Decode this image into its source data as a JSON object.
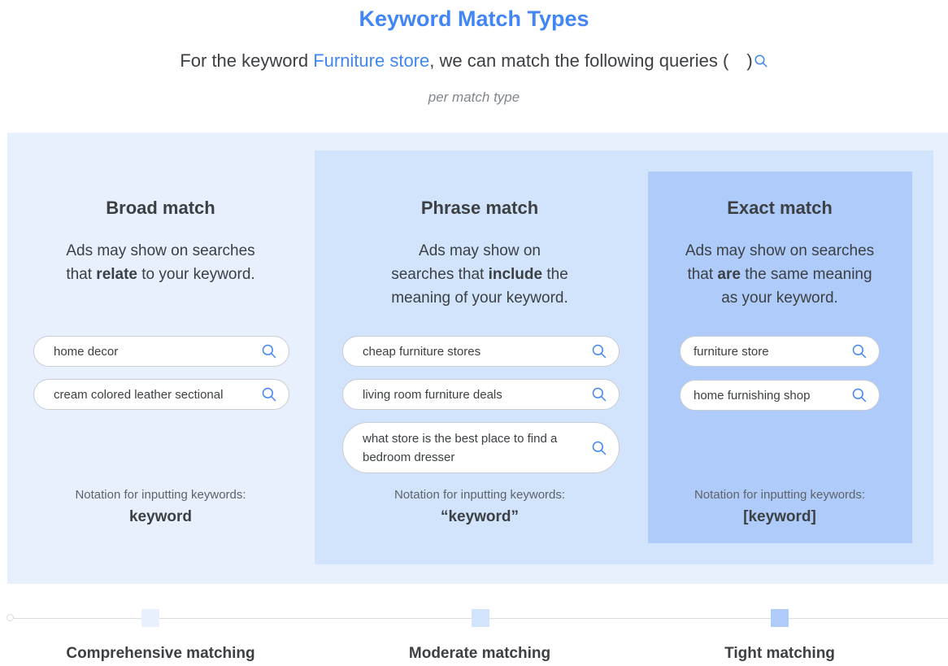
{
  "header": {
    "title": "Keyword Match Types",
    "subtitle_prefix": "For the keyword",
    "keyword": "Furniture store",
    "subtitle_suffix": ", we can match the following queries (",
    "subtitle_close": ")",
    "subtitle_icon": "search-icon",
    "per_match_type": "per match type"
  },
  "colors": {
    "accent": "#4285f4",
    "outer_panel": "#e8f0fe",
    "middle_panel": "#d2e3fc",
    "inner_panel": "#aecbfa"
  },
  "broad": {
    "title": "Broad match",
    "desc_line1": "Ads may show on searches",
    "desc_pre": "that ",
    "desc_bold": "relate",
    "desc_post": " to your keyword.",
    "queries": [
      "home decor",
      "cream colored leather sectional"
    ],
    "notation_label": "Notation for inputting keywords:",
    "notation": "keyword"
  },
  "phrase": {
    "title": "Phrase match",
    "desc_line1": "Ads may show on",
    "desc_pre": "searches that ",
    "desc_bold": "include",
    "desc_post": " the",
    "desc_line3": "meaning of your keyword.",
    "queries": [
      "cheap furniture stores",
      "living room furniture deals",
      "what store is the best place to find a bedroom dresser"
    ],
    "notation_label": "Notation for inputting keywords:",
    "notation": "“keyword”"
  },
  "exact": {
    "title": "Exact match",
    "desc_line1": "Ads may show on searches",
    "desc_pre": "that ",
    "desc_bold": "are",
    "desc_post": " the same meaning",
    "desc_line3": "as your keyword.",
    "queries": [
      "furniture store",
      "home furnishing shop"
    ],
    "notation_label": "Notation for inputting keywords:",
    "notation": "[keyword]"
  },
  "scale": {
    "labels": [
      "Comprehensive matching",
      "Moderate matching",
      "Tight matching"
    ],
    "marker_colors": [
      "#e8f0fe",
      "#d2e3fc",
      "#aecbfa"
    ]
  }
}
